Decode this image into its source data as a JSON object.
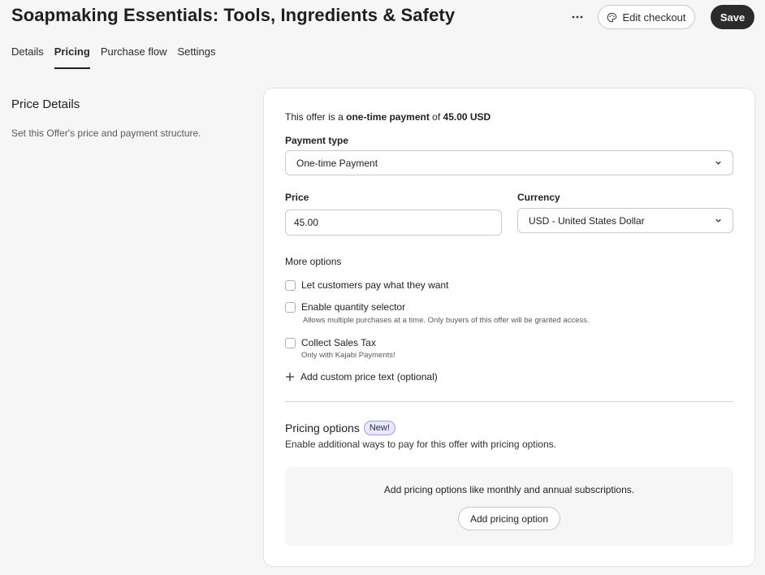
{
  "header": {
    "title": "Soapmaking Essentials: Tools, Ingredients & Safety",
    "more_icon": "more-horizontal-icon",
    "edit_checkout_label": "Edit checkout",
    "edit_checkout_icon": "palette-icon",
    "save_label": "Save"
  },
  "tabs": [
    {
      "label": "Details",
      "active": false
    },
    {
      "label": "Pricing",
      "active": true
    },
    {
      "label": "Purchase flow",
      "active": false
    },
    {
      "label": "Settings",
      "active": false
    }
  ],
  "section": {
    "title": "Price Details",
    "description": "Set this Offer's price and payment structure."
  },
  "card": {
    "summary": {
      "prefix": "This offer is a ",
      "payment_kind": "one-time payment",
      "middle": " of ",
      "amount": "45.00 USD"
    },
    "payment_type": {
      "label": "Payment type",
      "value": "One-time Payment"
    },
    "price": {
      "label": "Price",
      "value": "45.00"
    },
    "currency": {
      "label": "Currency",
      "value": "USD - United States Dollar"
    },
    "more_options": {
      "title": "More options",
      "pay_what_they_want": {
        "label": "Let customers pay what they want",
        "checked": false
      },
      "quantity_selector": {
        "label": "Enable quantity selector",
        "hint": "Allows multiple purchases at a time. Only buyers of this offer will be granted access.",
        "checked": false
      },
      "sales_tax": {
        "label": "Collect Sales Tax",
        "hint": "Only with Kajabi Payments!",
        "checked": false
      },
      "custom_price_text": "Add custom price text (optional)"
    },
    "pricing_options": {
      "title": "Pricing options",
      "badge": "New!",
      "description": "Enable additional ways to pay for this offer with pricing options.",
      "empty_text": "Add pricing options like monthly and annual subscriptions.",
      "add_button": "Add pricing option"
    }
  },
  "colors": {
    "primary_button": "#2b2b2b",
    "badge_bg": "#ebe9ff",
    "badge_border": "#9e97e6",
    "page_bg": "#f6f6f6"
  }
}
